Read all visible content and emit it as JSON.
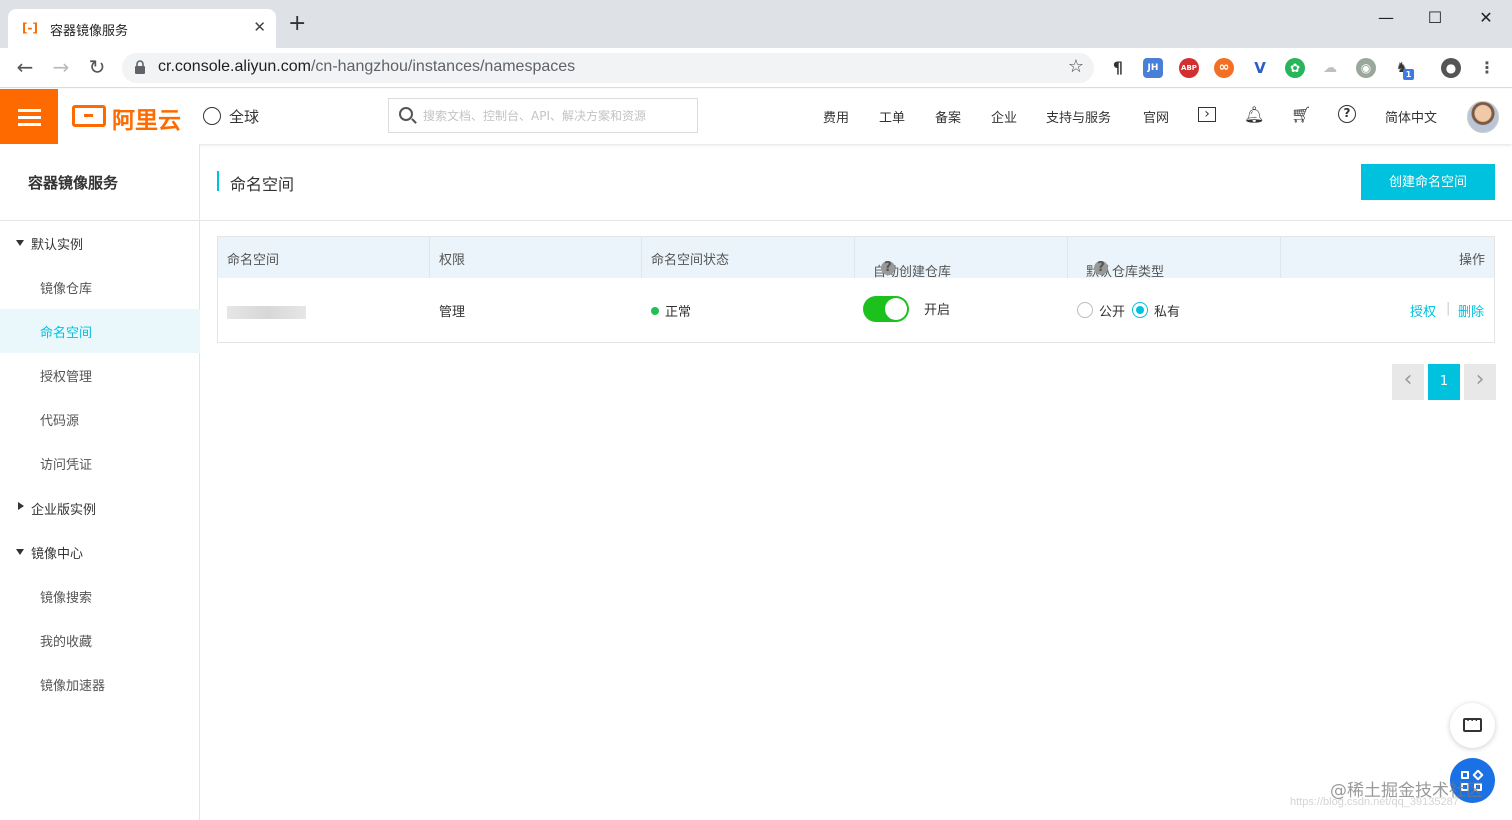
{
  "browser": {
    "tab_title": "容器镜像服务",
    "new_tab_symbol": "+",
    "url_host": "cr.console.aliyun.com",
    "url_path": "/cn-hangzhou/instances/namespaces",
    "extensions": [
      {
        "name": "paragraph-ext-icon",
        "label": "¶",
        "color": "#ffffff"
      },
      {
        "name": "jh-ext-icon",
        "label": "JH",
        "color": "#4a7fd8"
      },
      {
        "name": "adblock-plus-icon",
        "label": "ABP",
        "color": "#d32f2f"
      },
      {
        "name": "infinity-ext-icon",
        "label": "∞",
        "color": "#f36f23"
      },
      {
        "name": "vue-devtools-icon",
        "label": "V",
        "color": "#2a5ec5"
      },
      {
        "name": "green-ext-icon",
        "label": "✿",
        "color": "#29b55b"
      },
      {
        "name": "cloud-ext-icon",
        "label": "☁",
        "color": "#bfbfbf"
      },
      {
        "name": "owl-ext-icon",
        "label": "◉",
        "color": "#9aa79a"
      },
      {
        "name": "ghost-ext-icon",
        "label": "1",
        "color": "#3d7be4"
      }
    ]
  },
  "header": {
    "brand": "阿里云",
    "region": "全球",
    "search_placeholder": "搜索文档、控制台、API、解决方案和资源",
    "nav": [
      "费用",
      "工单",
      "备案",
      "企业",
      "支持与服务",
      "官网"
    ],
    "language": "简体中文"
  },
  "sidebar": {
    "title": "容器镜像服务",
    "groups": [
      {
        "label": "默认实例",
        "expanded": true,
        "items": [
          "镜像仓库",
          "命名空间",
          "授权管理",
          "代码源",
          "访问凭证"
        ]
      },
      {
        "label": "企业版实例",
        "expanded": false,
        "items": []
      },
      {
        "label": "镜像中心",
        "expanded": true,
        "items": [
          "镜像搜索",
          "我的收藏",
          "镜像加速器"
        ]
      }
    ],
    "active_item": "命名空间"
  },
  "main": {
    "title": "命名空间",
    "create_button": "创建命名空间",
    "table": {
      "columns": [
        "命名空间",
        "权限",
        "命名空间状态",
        "自动创建仓库",
        "默认仓库类型",
        "操作"
      ],
      "help_mark": "?",
      "row": {
        "permission": "管理",
        "status": "正常",
        "status_color": "#1fc054",
        "auto_create_label": "开启",
        "auto_create_on": true,
        "repo_type_options": [
          "公开",
          "私有"
        ],
        "repo_type_selected": "私有",
        "actions": [
          "授权",
          "删除"
        ],
        "action_separator": "|"
      }
    },
    "pagination": {
      "current_page": "1"
    }
  },
  "overlay": {
    "watermark": "@稀土掘金技术社区",
    "watermark_url": "https://blog.csdn.net/qq_39135287"
  },
  "colors": {
    "brand_orange": "#ff6a00",
    "accent_cyan": "#00c1de",
    "toggle_green": "#1dc11d"
  }
}
